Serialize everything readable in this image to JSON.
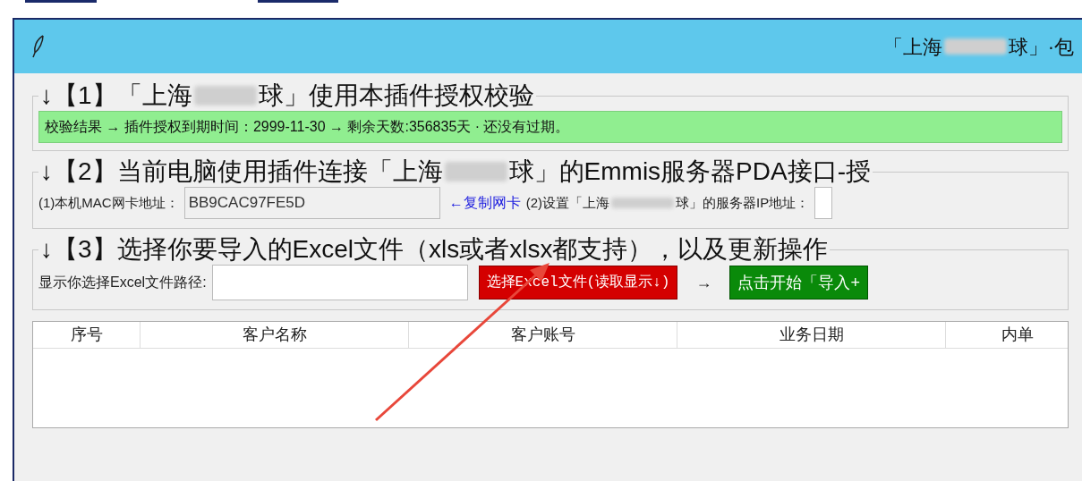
{
  "window": {
    "title_parts": [
      "「上海",
      "球」·包"
    ]
  },
  "license_section": {
    "heading_parts": [
      "↓【1】「上海",
      "球」使用本插件授权校验"
    ],
    "result": "校验结果 → 插件授权到期时间：2999-11-30 → 剩余天数:356835天 · 还没有过期。"
  },
  "connection_section": {
    "heading_parts": [
      "↓【2】当前电脑使用插件连接「上海",
      "球」的Emmis服务器PDA接口-授"
    ],
    "mac_label": "(1)本机MAC网卡地址：",
    "mac_value": "BB9CAC97FE5D",
    "copy_link": "←复制网卡",
    "ip_label_parts": [
      "(2)设置「上海",
      "球」的服务器IP地址："
    ]
  },
  "import_section": {
    "heading": "↓【3】选择你要导入的Excel文件（xls或者xlsx都支持），以及更新操作",
    "path_label": "显示你选择Excel文件路径:",
    "choose_button": "选择Excel文件(读取显示↓)",
    "arrow": "→",
    "start_button": "点击开始「导入+"
  },
  "table": {
    "columns": [
      "序号",
      "客户名称",
      "客户账号",
      "业务日期",
      "内单"
    ]
  }
}
